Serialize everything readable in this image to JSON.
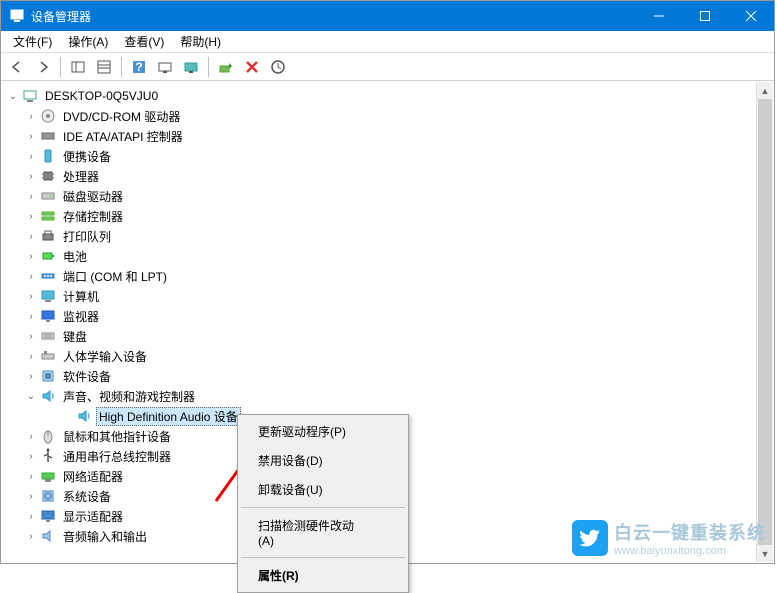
{
  "window": {
    "title": "设备管理器"
  },
  "menubar": {
    "file": "文件(F)",
    "action": "操作(A)",
    "view": "查看(V)",
    "help": "帮助(H)"
  },
  "tree": {
    "root": "DESKTOP-0Q5VJU0",
    "nodes": [
      {
        "icon": "disc",
        "label": "DVD/CD-ROM 驱动器"
      },
      {
        "icon": "ide",
        "label": "IDE ATA/ATAPI 控制器"
      },
      {
        "icon": "portable",
        "label": "便携设备"
      },
      {
        "icon": "cpu",
        "label": "处理器"
      },
      {
        "icon": "disk",
        "label": "磁盘驱动器"
      },
      {
        "icon": "storage",
        "label": "存储控制器"
      },
      {
        "icon": "printer",
        "label": "打印队列"
      },
      {
        "icon": "battery",
        "label": "电池"
      },
      {
        "icon": "port",
        "label": "端口 (COM 和 LPT)"
      },
      {
        "icon": "computer",
        "label": "计算机"
      },
      {
        "icon": "monitor",
        "label": "监视器"
      },
      {
        "icon": "keyboard",
        "label": "键盘"
      },
      {
        "icon": "hid",
        "label": "人体学输入设备"
      },
      {
        "icon": "software",
        "label": "软件设备"
      },
      {
        "icon": "sound",
        "label": "声音、视频和游戏控制器",
        "expanded": true,
        "children": [
          {
            "icon": "sound",
            "label": "High Definition Audio 设备",
            "selected": true
          }
        ]
      },
      {
        "icon": "mouse",
        "label": "鼠标和其他指针设备"
      },
      {
        "icon": "usb",
        "label": "通用串行总线控制器"
      },
      {
        "icon": "network",
        "label": "网络适配器"
      },
      {
        "icon": "system",
        "label": "系统设备"
      },
      {
        "icon": "display",
        "label": "显示适配器"
      },
      {
        "icon": "audioio",
        "label": "音频输入和输出"
      }
    ]
  },
  "contextmenu": {
    "update_driver": "更新驱动程序(P)",
    "disable_device": "禁用设备(D)",
    "uninstall_device": "卸载设备(U)",
    "scan_hardware": "扫描检测硬件改动(A)",
    "properties": "属性(R)"
  },
  "watermark": {
    "line1": "白云一键重装系统",
    "line2": "www.baiyunxitong.com"
  }
}
